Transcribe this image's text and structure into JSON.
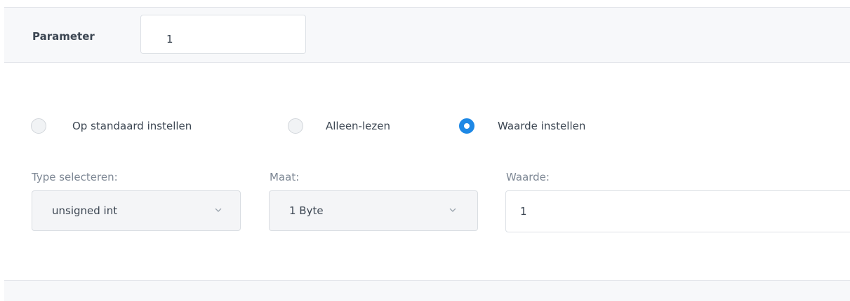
{
  "parameter": {
    "label": "Parameter",
    "value": "1"
  },
  "mode_options": [
    {
      "label": "Op standaard instellen",
      "checked": false
    },
    {
      "label": "Alleen-lezen",
      "checked": false
    },
    {
      "label": "Waarde instellen",
      "checked": true
    }
  ],
  "type_field": {
    "label": "Type selecteren:",
    "selected": "unsigned int",
    "icon": "chevron-down-icon"
  },
  "size_field": {
    "label": "Maat:",
    "selected": "1 Byte",
    "icon": "chevron-down-icon"
  },
  "value_field": {
    "label": "Waarde:",
    "value": "1"
  },
  "colors": {
    "accent": "#1e88e5",
    "text": "#3c4652",
    "muted_label": "#7d8794"
  }
}
